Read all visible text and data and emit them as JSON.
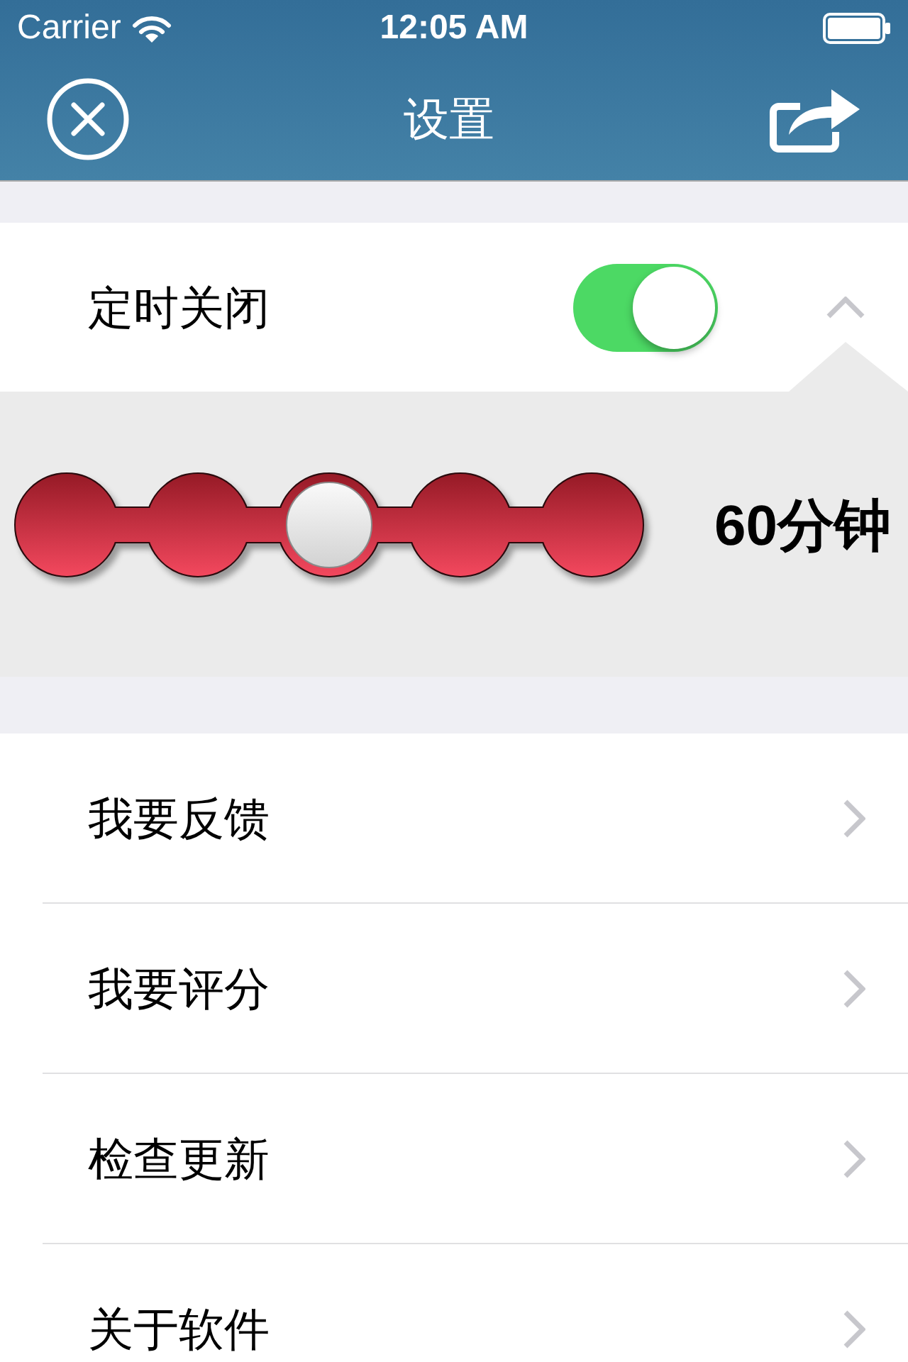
{
  "status_bar": {
    "carrier": "Carrier",
    "time": "12:05 AM"
  },
  "nav_bar": {
    "title": "设置"
  },
  "timer": {
    "label": "定时关闭",
    "on": true,
    "expanded": true,
    "stops": [
      {
        "selected": false
      },
      {
        "selected": false
      },
      {
        "selected": true
      },
      {
        "selected": false
      },
      {
        "selected": false
      }
    ],
    "value": "60分钟"
  },
  "menu_items": [
    {
      "label": "我要反馈"
    },
    {
      "label": "我要评分"
    },
    {
      "label": "检查更新"
    },
    {
      "label": "关于软件"
    }
  ]
}
